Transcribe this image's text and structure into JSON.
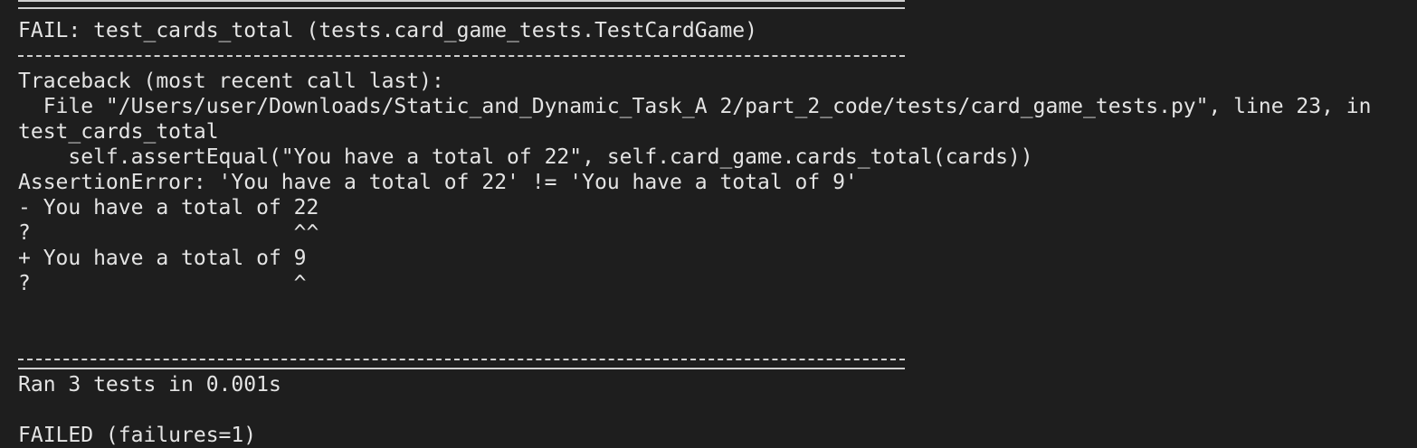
{
  "terminal": {
    "lines": {
      "fail_header": "FAIL: test_cards_total (tests.card_game_tests.TestCardGame)",
      "traceback_header": "Traceback (most recent call last):",
      "file_line": "  File \"/Users/user/Downloads/Static_and_Dynamic_Task_A 2/part_2_code/tests/card_game_tests.py\", line 23, in",
      "func_name": "test_cards_total",
      "code_line": "    self.assertEqual(\"You have a total of 22\", self.card_game.cards_total(cards))",
      "assertion_error": "AssertionError: 'You have a total of 22' != 'You have a total of 9'",
      "diff_minus": "- You have a total of 22",
      "diff_hint_1": "?                     ^^",
      "diff_plus": "+ You have a total of 9",
      "diff_hint_2": "?                     ^",
      "ran_summary": "Ran 3 tests in 0.001s",
      "failed_summary": "FAILED (failures=1)"
    }
  }
}
